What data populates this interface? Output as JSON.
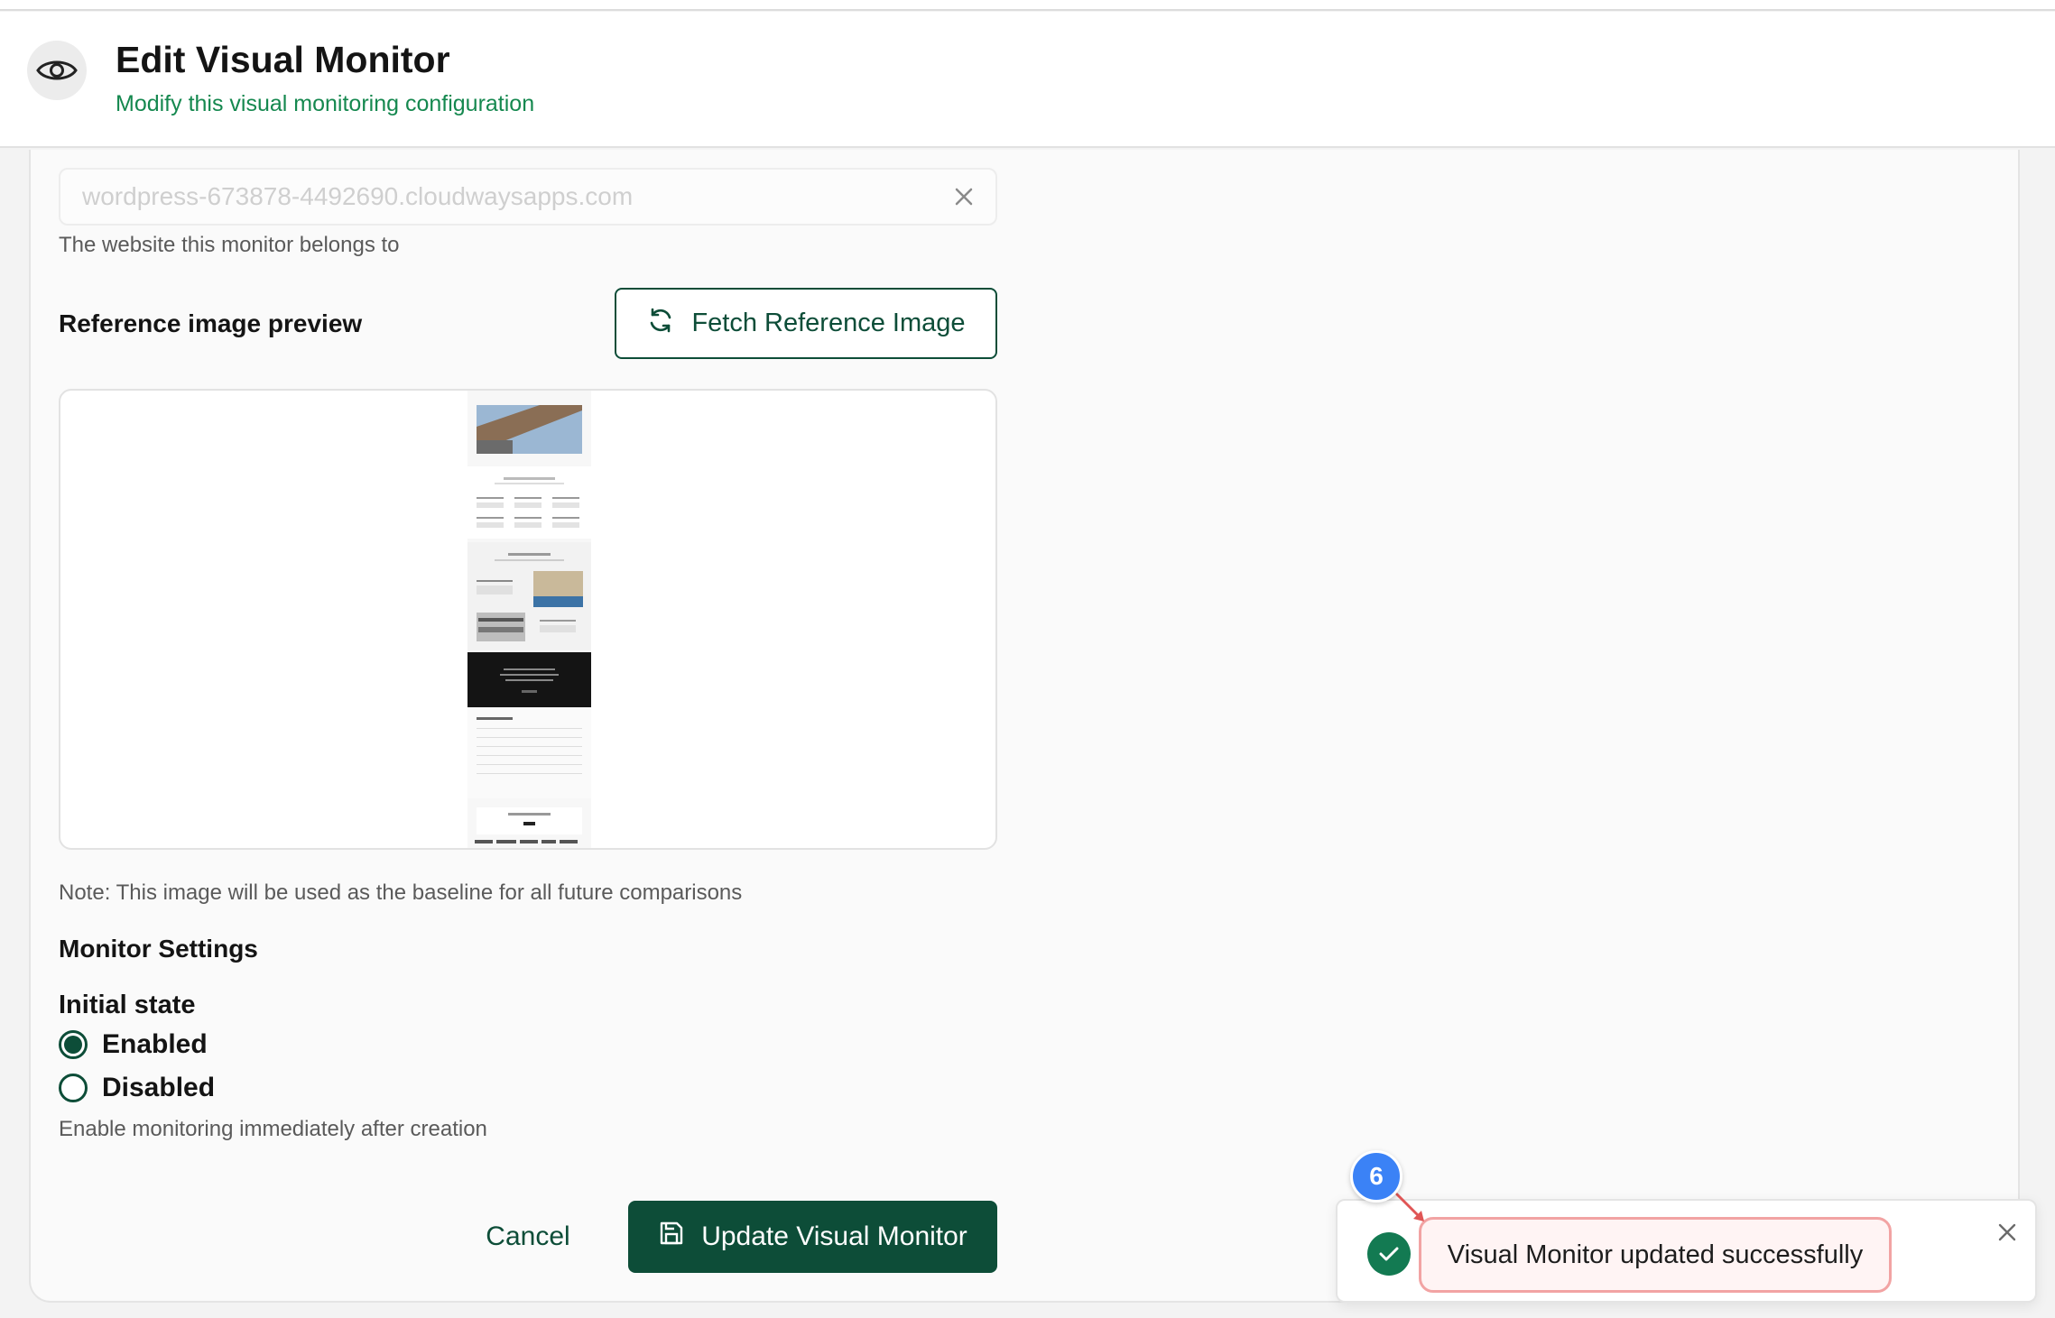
{
  "header": {
    "title": "Edit Visual Monitor",
    "subtitle": "Modify this visual monitoring configuration",
    "icon": "eye-icon"
  },
  "website": {
    "value": "wordpress-673878-4492690.cloudwaysapps.com",
    "helper": "The website this monitor belongs to"
  },
  "reference": {
    "label": "Reference image preview",
    "fetch_button": "Fetch Reference Image",
    "note": "Note: This image will be used as the baseline for all future comparisons"
  },
  "settings": {
    "title": "Monitor Settings",
    "initial_state_label": "Initial state",
    "options": [
      {
        "label": "Enabled",
        "selected": true
      },
      {
        "label": "Disabled",
        "selected": false
      }
    ],
    "helper": "Enable monitoring immediately after creation"
  },
  "actions": {
    "cancel": "Cancel",
    "update": "Update Visual Monitor"
  },
  "toast": {
    "message": "Visual Monitor updated successfully"
  },
  "annotation": {
    "step": "6"
  },
  "colors": {
    "primary": "#0d4d38",
    "accent_green": "#15884f",
    "toast_highlight": "#f2a3a3",
    "step_badge": "#3b82f6"
  }
}
